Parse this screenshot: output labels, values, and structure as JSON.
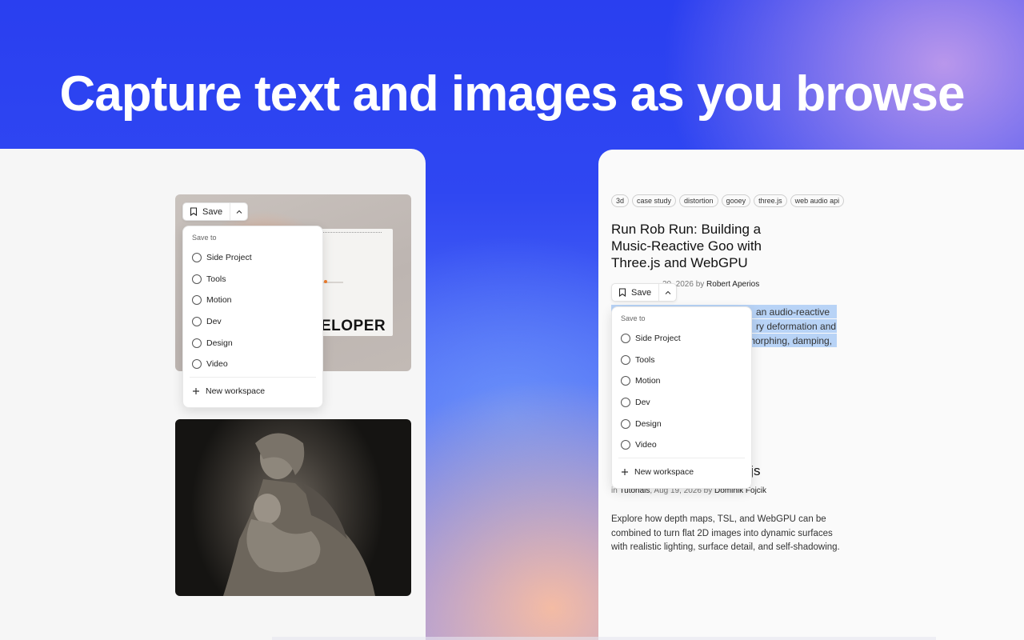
{
  "headline": "Capture text and images as you browse",
  "save_widget": {
    "save_label": "Save",
    "menu_heading": "Save to",
    "workspaces": [
      "Side Project",
      "Tools",
      "Motion",
      "Dev",
      "Design",
      "Video"
    ],
    "new_workspace_label": "New workspace"
  },
  "left_panel": {
    "card1_word": "ELOPER"
  },
  "right_panel": {
    "tags": [
      "3d",
      "case study",
      "distortion",
      "gooey",
      "three.js",
      "web audio api"
    ],
    "article1": {
      "title": "Run Rob Run: Building a Music-Reactive Goo with Three.js and WebGPU",
      "meta_visible": "20, 2026 by",
      "author": "Robert Aperios",
      "highlighted_lines": [
        "an audio-reactive",
        "ry deformation and",
        "morphing, damping,"
      ]
    },
    "article2": {
      "title_visible": "e.js",
      "meta_prefix": "in",
      "category": "Tutorials",
      "date": ", Aug 19, 2026 by",
      "author": "Dominik Fojcik",
      "excerpt": "Explore how depth maps, TSL, and WebGPU can be combined to turn flat 2D images into dynamic surfaces with realistic lighting, surface detail, and self-shadowing."
    }
  },
  "colors": {
    "background_top": "#2a3ff0",
    "highlight": "#b8d3f6",
    "panel": "#f6f6f6"
  }
}
